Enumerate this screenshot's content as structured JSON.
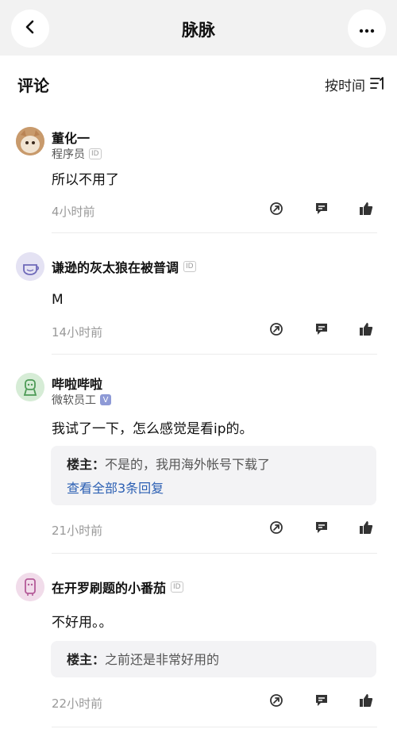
{
  "header": {
    "title": "脉脉",
    "back_icon": "chevron-left-icon",
    "more_icon": "more-horizontal-icon"
  },
  "section": {
    "title": "评论",
    "sort_label": "按时间",
    "sort_icon": "sort-icon"
  },
  "comments": [
    {
      "username": "董化一",
      "subtitle": "程序员",
      "id_badge": "ID",
      "text": "所以不用了",
      "time": "4小时前"
    },
    {
      "username": "谦逊的灰太狼在被普调",
      "id_badge": "ID",
      "text": "M",
      "time": "14小时前"
    },
    {
      "username": "哔啦哔啦",
      "subtitle": "微软员工",
      "verified_badge": "V",
      "text": "我试了一下，怎么感觉是看ip的。",
      "reply": {
        "author": "楼主：",
        "text": "不是的，我用海外帐号下载了",
        "view_all": "查看全部3条回复"
      },
      "time": "21小时前"
    },
    {
      "username": "在开罗刷题的小番茄",
      "id_badge": "ID",
      "text": "不好用。。",
      "reply": {
        "author": "楼主：",
        "text": "之前还是非常好用的"
      },
      "time": "22小时前"
    }
  ],
  "actions": {
    "share_icon": "share-icon",
    "comment_icon": "comment-icon",
    "like_icon": "thumbs-up-icon"
  },
  "colors": {
    "link": "#2b5fb3",
    "muted": "#999999",
    "header_bg": "#f2f2f2",
    "reply_bg": "#f3f3f5"
  }
}
